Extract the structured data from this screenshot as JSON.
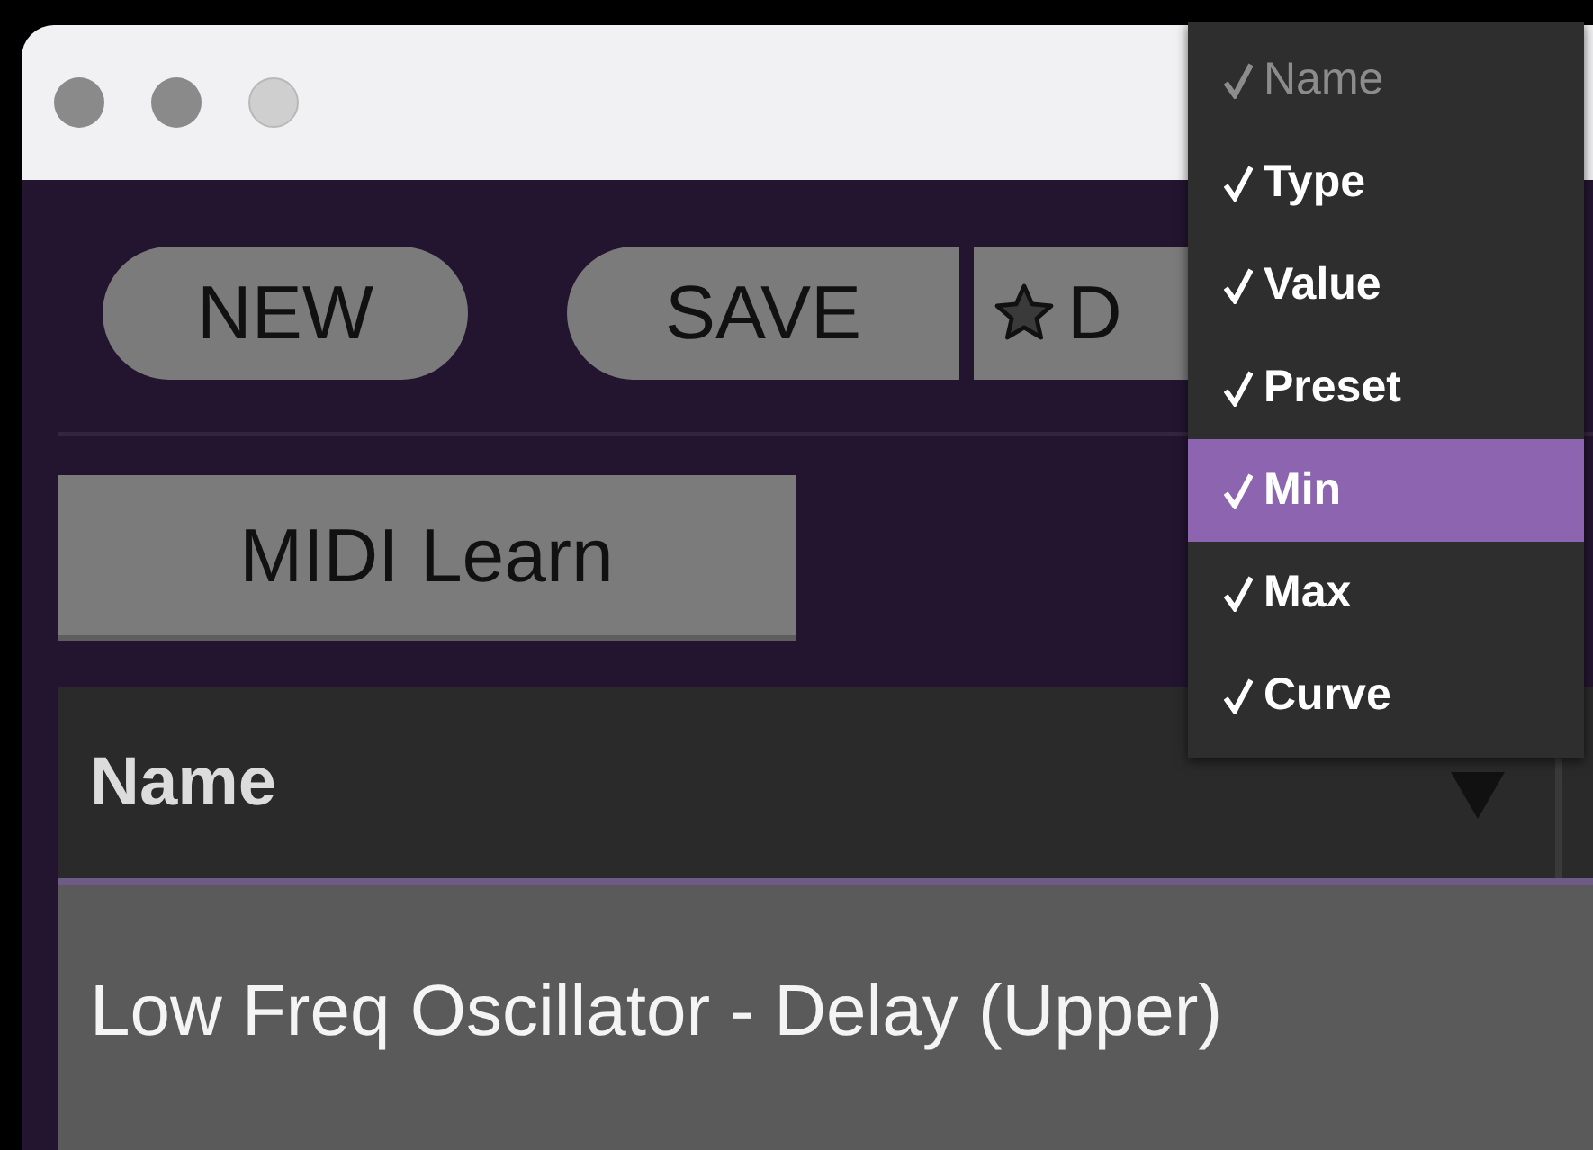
{
  "toolbar": {
    "buttons": [
      {
        "label": "NEW",
        "kind": "pill"
      },
      {
        "label": "SAVE",
        "kind": "left-pill"
      },
      {
        "label": "D",
        "kind": "star"
      }
    ]
  },
  "midi_learn": {
    "label": "MIDI Learn"
  },
  "table": {
    "columns": [
      {
        "label": "Name",
        "sorted": true
      }
    ],
    "rows": [
      {
        "cells": [
          "Low Freq Oscillator - Delay (Upper)"
        ]
      }
    ]
  },
  "column_menu": {
    "items": [
      {
        "label": "Name",
        "checked": true,
        "disabled": true,
        "selected": false
      },
      {
        "label": "Type",
        "checked": true,
        "disabled": false,
        "selected": false
      },
      {
        "label": "Value",
        "checked": true,
        "disabled": false,
        "selected": false
      },
      {
        "label": "Preset",
        "checked": true,
        "disabled": false,
        "selected": false
      },
      {
        "label": "Min",
        "checked": true,
        "disabled": false,
        "selected": true
      },
      {
        "label": "Max",
        "checked": true,
        "disabled": false,
        "selected": false
      },
      {
        "label": "Curve",
        "checked": true,
        "disabled": false,
        "selected": false
      }
    ]
  }
}
